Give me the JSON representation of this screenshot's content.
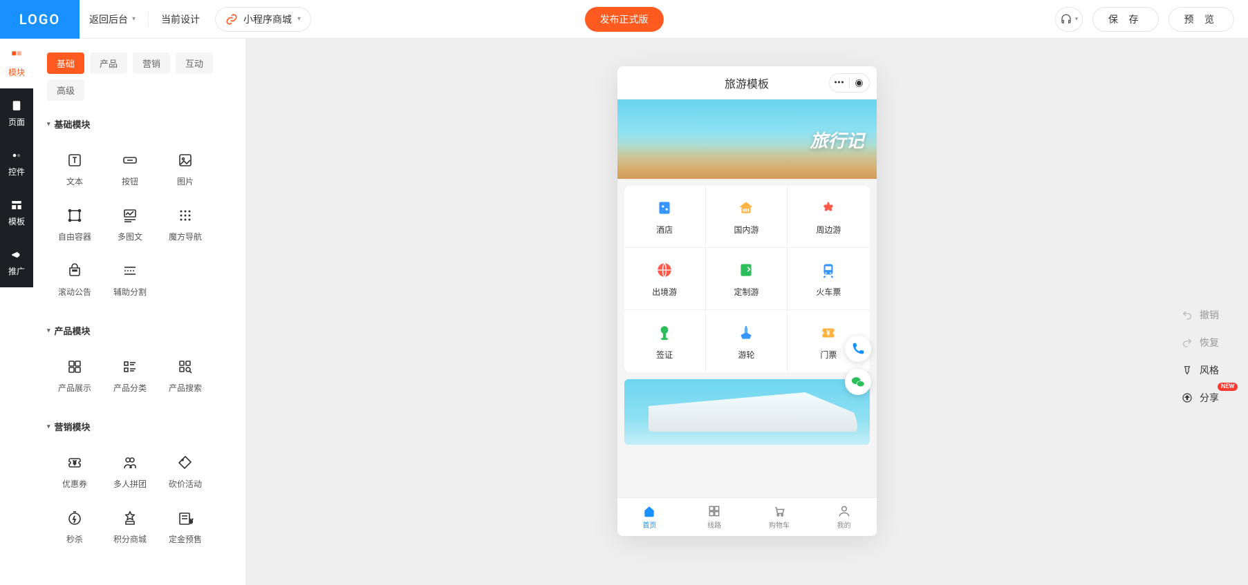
{
  "topbar": {
    "logo": "LOGO",
    "back": "返回后台",
    "current_design": "当前设计",
    "design_name": "小程序商城",
    "publish": "发布正式版",
    "save": "保 存",
    "preview": "预 览"
  },
  "rail": [
    {
      "label": "模块",
      "active": true
    },
    {
      "label": "页面",
      "active": false
    },
    {
      "label": "控件",
      "active": false
    },
    {
      "label": "模板",
      "active": false
    },
    {
      "label": "推广",
      "active": false
    }
  ],
  "tabs": [
    {
      "label": "基础",
      "active": true
    },
    {
      "label": "产品",
      "active": false
    },
    {
      "label": "营销",
      "active": false
    },
    {
      "label": "互动",
      "active": false
    },
    {
      "label": "高级",
      "active": false
    }
  ],
  "sections": [
    {
      "title": "基础模块",
      "items": [
        "文本",
        "按钮",
        "图片",
        "自由容器",
        "多图文",
        "魔方导航",
        "滚动公告",
        "辅助分割"
      ]
    },
    {
      "title": "产品模块",
      "items": [
        "产品展示",
        "产品分类",
        "产品搜索"
      ]
    },
    {
      "title": "营销模块",
      "items": [
        "优惠券",
        "多人拼团",
        "砍价活动",
        "秒杀",
        "积分商城",
        "定金预售"
      ]
    }
  ],
  "phone": {
    "title": "旅游模板",
    "banner_title": "旅行记",
    "nav": [
      "酒店",
      "国内游",
      "周边游",
      "出境游",
      "定制游",
      "火车票",
      "签证",
      "游轮",
      "门票"
    ],
    "tabbar": [
      {
        "label": "首页",
        "active": true
      },
      {
        "label": "线路",
        "active": false
      },
      {
        "label": "购物车",
        "active": false
      },
      {
        "label": "我的",
        "active": false
      }
    ]
  },
  "right_tools": {
    "undo": "撤销",
    "redo": "恢复",
    "style": "风格",
    "share": "分享",
    "new": "NEW"
  }
}
